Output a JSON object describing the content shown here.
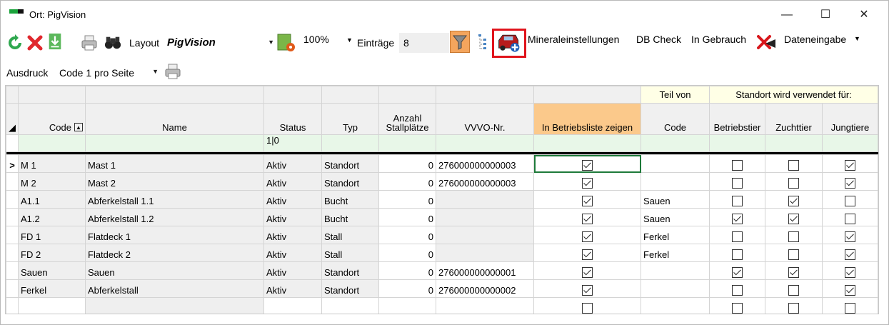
{
  "window": {
    "title": "Ort: PigVision",
    "controls": {
      "minimize": "—",
      "maximize": "☐",
      "close": "✕"
    }
  },
  "toolbar1": {
    "layout_label": "Layout",
    "layout_value": "PigVision",
    "zoom": "100%",
    "entries_label": "Einträge",
    "entries_value": "8",
    "mineral": "Mineraleinstellungen",
    "dbcheck": "DB Check",
    "inuse": "In Gebrauch",
    "dataentry": "Dateneingabe"
  },
  "toolbar2": {
    "print_label": "Ausdruck",
    "print_value": "Code 1 pro Seite"
  },
  "colors": {
    "accent_orange": "#fbc98b",
    "filter_green": "#e8f7e8",
    "highlight_red": "#e0141c"
  },
  "grid": {
    "group_headers": {
      "part_of": "Teil von",
      "location_used_for": "Standort wird verwendet für:"
    },
    "columns": [
      "Code",
      "Name",
      "Status",
      "Typ",
      "Anzahl Stallplätze",
      "VVVO-Nr.",
      "In Betriebsliste zeigen",
      "Code",
      "Betriebstier",
      "Zuchttier",
      "Jungtiere"
    ],
    "filter_status": "1|0",
    "current_row_marker": ">",
    "rows": [
      {
        "code": "M 1",
        "name": "Mast 1",
        "status": "Aktiv",
        "typ": "Standort",
        "count": "0",
        "vvvo": "276000000000003",
        "show": true,
        "part": "",
        "betrieb": false,
        "zucht": false,
        "jung": true
      },
      {
        "code": "M 2",
        "name": "Mast 2",
        "status": "Aktiv",
        "typ": "Standort",
        "count": "0",
        "vvvo": "276000000000003",
        "show": true,
        "part": "",
        "betrieb": false,
        "zucht": false,
        "jung": true
      },
      {
        "code": "A1.1",
        "name": "Abferkelstall 1.1",
        "status": "Aktiv",
        "typ": "Bucht",
        "count": "0",
        "vvvo": "",
        "show": true,
        "part": "Sauen",
        "betrieb": false,
        "zucht": true,
        "jung": false
      },
      {
        "code": "A1.2",
        "name": "Abferkelstall 1.2",
        "status": "Aktiv",
        "typ": "Bucht",
        "count": "0",
        "vvvo": "",
        "show": true,
        "part": "Sauen",
        "betrieb": true,
        "zucht": true,
        "jung": false
      },
      {
        "code": "FD 1",
        "name": "Flatdeck 1",
        "status": "Aktiv",
        "typ": "Stall",
        "count": "0",
        "vvvo": "",
        "show": true,
        "part": "Ferkel",
        "betrieb": false,
        "zucht": false,
        "jung": true
      },
      {
        "code": "FD 2",
        "name": "Flatdeck 2",
        "status": "Aktiv",
        "typ": "Stall",
        "count": "0",
        "vvvo": "",
        "show": true,
        "part": "Ferkel",
        "betrieb": false,
        "zucht": false,
        "jung": true
      },
      {
        "code": "Sauen",
        "name": "Sauen",
        "status": "Aktiv",
        "typ": "Standort",
        "count": "0",
        "vvvo": "276000000000001",
        "show": true,
        "part": "",
        "betrieb": true,
        "zucht": true,
        "jung": true
      },
      {
        "code": "Ferkel",
        "name": "Abferkelstall",
        "status": "Aktiv",
        "typ": "Standort",
        "count": "0",
        "vvvo": "276000000000002",
        "show": true,
        "part": "",
        "betrieb": false,
        "zucht": false,
        "jung": true
      }
    ]
  }
}
